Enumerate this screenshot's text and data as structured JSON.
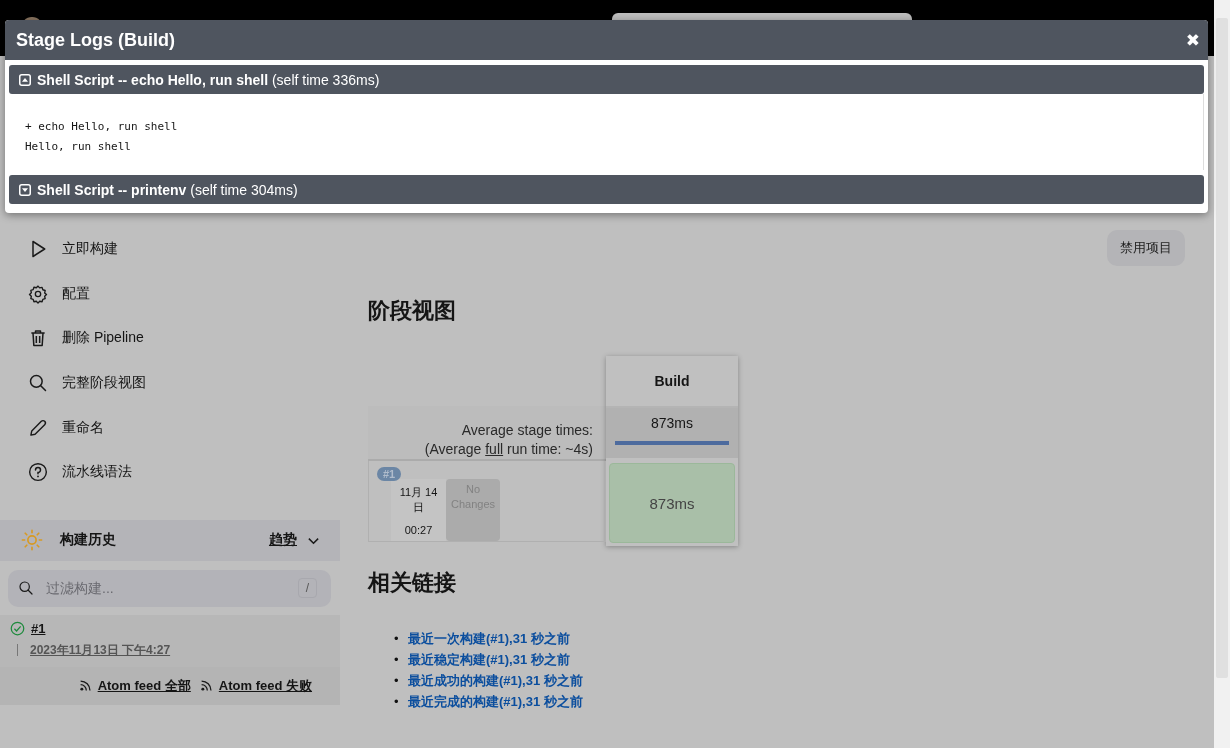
{
  "modal": {
    "title": "Stage Logs (Build)",
    "close": "✖",
    "steps": [
      {
        "name": "Shell Script -- echo Hello, run shell",
        "self_time": "(self time 336ms)",
        "expanded": true,
        "log": [
          "+ echo Hello, run shell",
          "Hello, run shell"
        ]
      },
      {
        "name": "Shell Script -- printenv",
        "self_time": "(self time 304ms)",
        "expanded": false
      }
    ]
  },
  "sidebar": {
    "tasks": [
      {
        "kind": "play",
        "label": "立即构建"
      },
      {
        "kind": "gear",
        "label": "配置"
      },
      {
        "kind": "trash",
        "label": "删除 Pipeline"
      },
      {
        "kind": "search",
        "label": "完整阶段视图"
      },
      {
        "kind": "pencil",
        "label": "重命名"
      },
      {
        "kind": "help",
        "label": "流水线语法"
      }
    ],
    "build_history": {
      "title": "构建历史",
      "trend": "趋势",
      "filter_placeholder": "过滤构建...",
      "shortcut": "/",
      "builds": [
        {
          "number": "#1",
          "date": "2023年11月13日 下午4:27",
          "color": "#1d8a3c"
        }
      ],
      "feeds": [
        "Atom feed 全部",
        "Atom feed 失败"
      ]
    }
  },
  "main": {
    "disable_button": "禁用项目",
    "stage_view": {
      "title": "阶段视图",
      "avg_label": "Average stage times:",
      "avg_run": {
        "before": "(Average ",
        "link": "full",
        "after": " run time: ~4s)"
      },
      "stages": [
        {
          "name": "Build",
          "avg": "873ms",
          "level": 1
        }
      ],
      "runs": [
        {
          "badge": "#1",
          "date": "11月 14 日",
          "time": "00:27",
          "changes": "No Changes",
          "cells": [
            {
              "text": "873ms",
              "color": "#a9bfa8"
            }
          ]
        }
      ]
    },
    "links": {
      "title": "相关链接",
      "items": [
        {
          "marker": "•",
          "text": "最近一次构建(#1),31 秒之前"
        },
        {
          "marker": "•",
          "text": "最近稳定构建(#1),31 秒之前"
        },
        {
          "marker": "•",
          "text": "最近成功的构建(#1),31 秒之前"
        },
        {
          "marker": "•",
          "text": "最近完成的构建(#1),31 秒之前"
        }
      ]
    }
  }
}
